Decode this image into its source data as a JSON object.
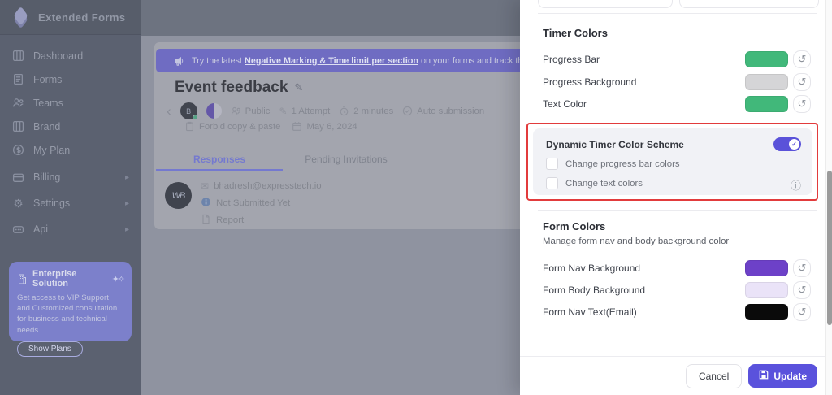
{
  "app": {
    "brand": "Extended Forms"
  },
  "icons": {
    "reset": "↺",
    "mail": "✉",
    "sparkles": "✦✧",
    "check": "✓",
    "gear": "⚙",
    "pencil": "✎",
    "chevron_left": "‹",
    "submenu_arrow": "▸",
    "info_circled": "ⓘ"
  },
  "sidebar": {
    "items": [
      {
        "label": "Dashboard",
        "icon": "dashboard-icon",
        "has_submenu": false
      },
      {
        "label": "Forms",
        "icon": "forms-icon",
        "has_submenu": false
      },
      {
        "label": "Teams",
        "icon": "teams-icon",
        "has_submenu": false
      },
      {
        "label": "Brand",
        "icon": "brand-icon",
        "has_submenu": false
      },
      {
        "label": "My Plan",
        "icon": "my-plan-icon",
        "has_submenu": false
      },
      {
        "label": "Billing",
        "icon": "billing-icon",
        "has_submenu": true
      },
      {
        "label": "Settings",
        "icon": "settings-icon",
        "has_submenu": true
      },
      {
        "label": "Api",
        "icon": "api-icon",
        "has_submenu": true
      }
    ],
    "enterprise": {
      "title": "Enterprise Solution",
      "description": "Get access to VIP Support and Customized consultation for business and technical needs.",
      "button": "Show Plans"
    }
  },
  "main": {
    "banner": {
      "prefix": "Try the latest ",
      "link": "Negative Marking & Time limit per section",
      "suffix": " on your forms and track the respo"
    },
    "title": "Event feedback",
    "meta": {
      "avatar_monogram": "B",
      "visibility": "Public",
      "attempts": "1 Attempt",
      "duration": "2 minutes",
      "submission": "Auto submission",
      "copy_paste": "Forbid copy & paste",
      "date": "May 6, 2024"
    },
    "tabs": [
      {
        "label": "Responses",
        "active": true
      },
      {
        "label": "Pending Invitations",
        "active": false
      }
    ],
    "response": {
      "monogram": "WB",
      "email": "bhadresh@expresstech.io",
      "status": "Not Submitted Yet",
      "report": "Report"
    }
  },
  "panel": {
    "timer_colors": {
      "heading": "Timer Colors",
      "rows": [
        {
          "label": "Progress Bar",
          "color": "#41b87a"
        },
        {
          "label": "Progress Background",
          "color": "#d5d5d7"
        },
        {
          "label": "Text Color",
          "color": "#41b87a"
        }
      ]
    },
    "dynamic": {
      "title": "Dynamic Timer Color Scheme",
      "enabled": true,
      "options": [
        {
          "label": "Change progress bar colors",
          "checked": false
        },
        {
          "label": "Change text colors",
          "checked": false
        }
      ]
    },
    "form_colors": {
      "heading": "Form Colors",
      "subtitle": "Manage form nav and body background color",
      "rows": [
        {
          "label": "Form Nav Background",
          "color": "#6d41c8"
        },
        {
          "label": "Form Body Background",
          "color": "#eae3f8"
        },
        {
          "label": "Form Nav Text(Email)",
          "color": "#0a0a0a"
        }
      ]
    },
    "footer": {
      "cancel": "Cancel",
      "update": "Update"
    }
  },
  "colors": {
    "accent": "#5a52d9",
    "highlight_border": "#e23b3c",
    "swatch_green": "#41b87a",
    "banner_purple": "#6f6cc2"
  }
}
